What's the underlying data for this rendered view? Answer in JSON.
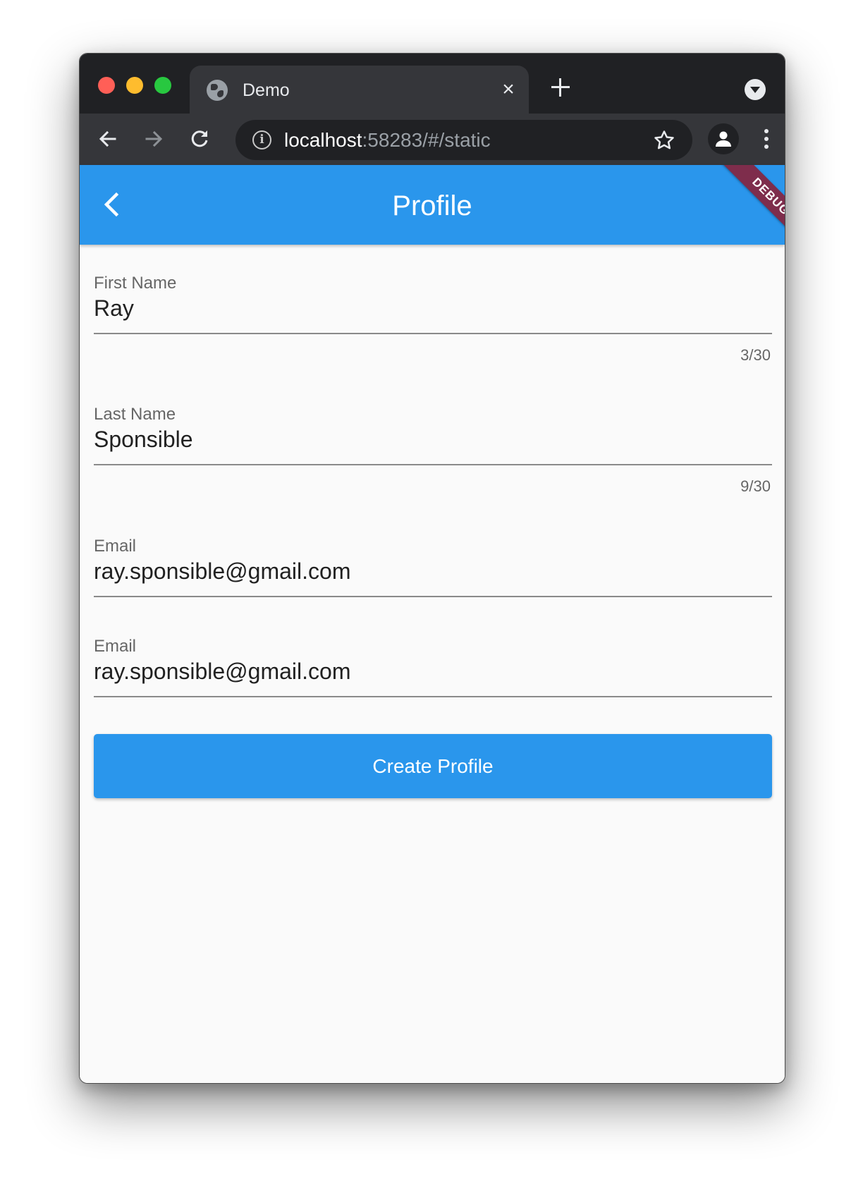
{
  "browser": {
    "tab_title": "Demo",
    "tab_close": "×",
    "url_host": "localhost",
    "url_rest": ":58283/#/static",
    "icons": {
      "favicon": "globe-icon",
      "close": "close-icon",
      "new_tab": "plus-icon",
      "tab_search": "chevron-down-icon",
      "back": "arrow-left-icon",
      "forward": "arrow-right-icon",
      "reload": "reload-icon",
      "site_info": "info-icon",
      "bookmark": "star-icon",
      "profile": "person-icon",
      "menu": "more-vertical-icon"
    },
    "site_info_glyph": "i"
  },
  "app": {
    "title": "Profile",
    "debug_banner": "DEBUG",
    "accent_color": "#2a96ec",
    "banner_color": "#7e2d4c",
    "fields": [
      {
        "label": "First Name",
        "value": "Ray",
        "counter": "3/30"
      },
      {
        "label": "Last Name",
        "value": "Sponsible",
        "counter": "9/30"
      },
      {
        "label": "Email",
        "value": "ray.sponsible@gmail.com"
      },
      {
        "label": "Email",
        "value": "ray.sponsible@gmail.com"
      }
    ],
    "submit_label": "Create Profile"
  }
}
